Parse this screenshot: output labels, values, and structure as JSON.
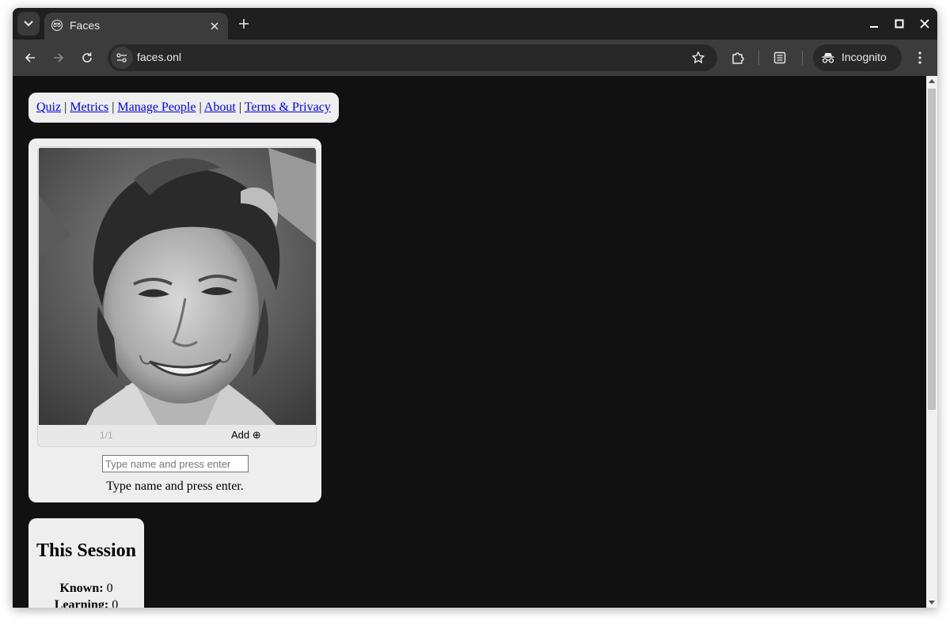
{
  "browser": {
    "tab_title": "Faces",
    "url": "faces.onl",
    "profile_label": "Incognito"
  },
  "nav": {
    "links": [
      "Quiz",
      "Metrics",
      "Manage People",
      "About",
      "Terms & Privacy"
    ],
    "separator": "|"
  },
  "face_card": {
    "counter": "1/1",
    "add_label": "Add ⊕",
    "input_placeholder": "Type name and press enter",
    "hint": "Type name and press enter."
  },
  "session": {
    "title": "This Session",
    "stats": [
      {
        "label": "Known:",
        "value": "0"
      },
      {
        "label": "Learning:",
        "value": "0"
      }
    ]
  },
  "colors": {
    "page_background": "#111111",
    "card_background": "#eeeeee",
    "link": "#0000ee",
    "browser_frame": "#1f1f1f",
    "toolbar": "#3c3c3c"
  },
  "icons": [
    "tab-search-icon",
    "incognito-favicon-icon",
    "close-tab-icon",
    "new-tab-icon",
    "minimize-icon",
    "maximize-icon",
    "close-window-icon",
    "back-icon",
    "forward-icon",
    "reload-icon",
    "site-info-icon",
    "bookmark-star-icon",
    "extensions-icon",
    "reading-list-icon",
    "incognito-icon",
    "more-menu-icon"
  ]
}
